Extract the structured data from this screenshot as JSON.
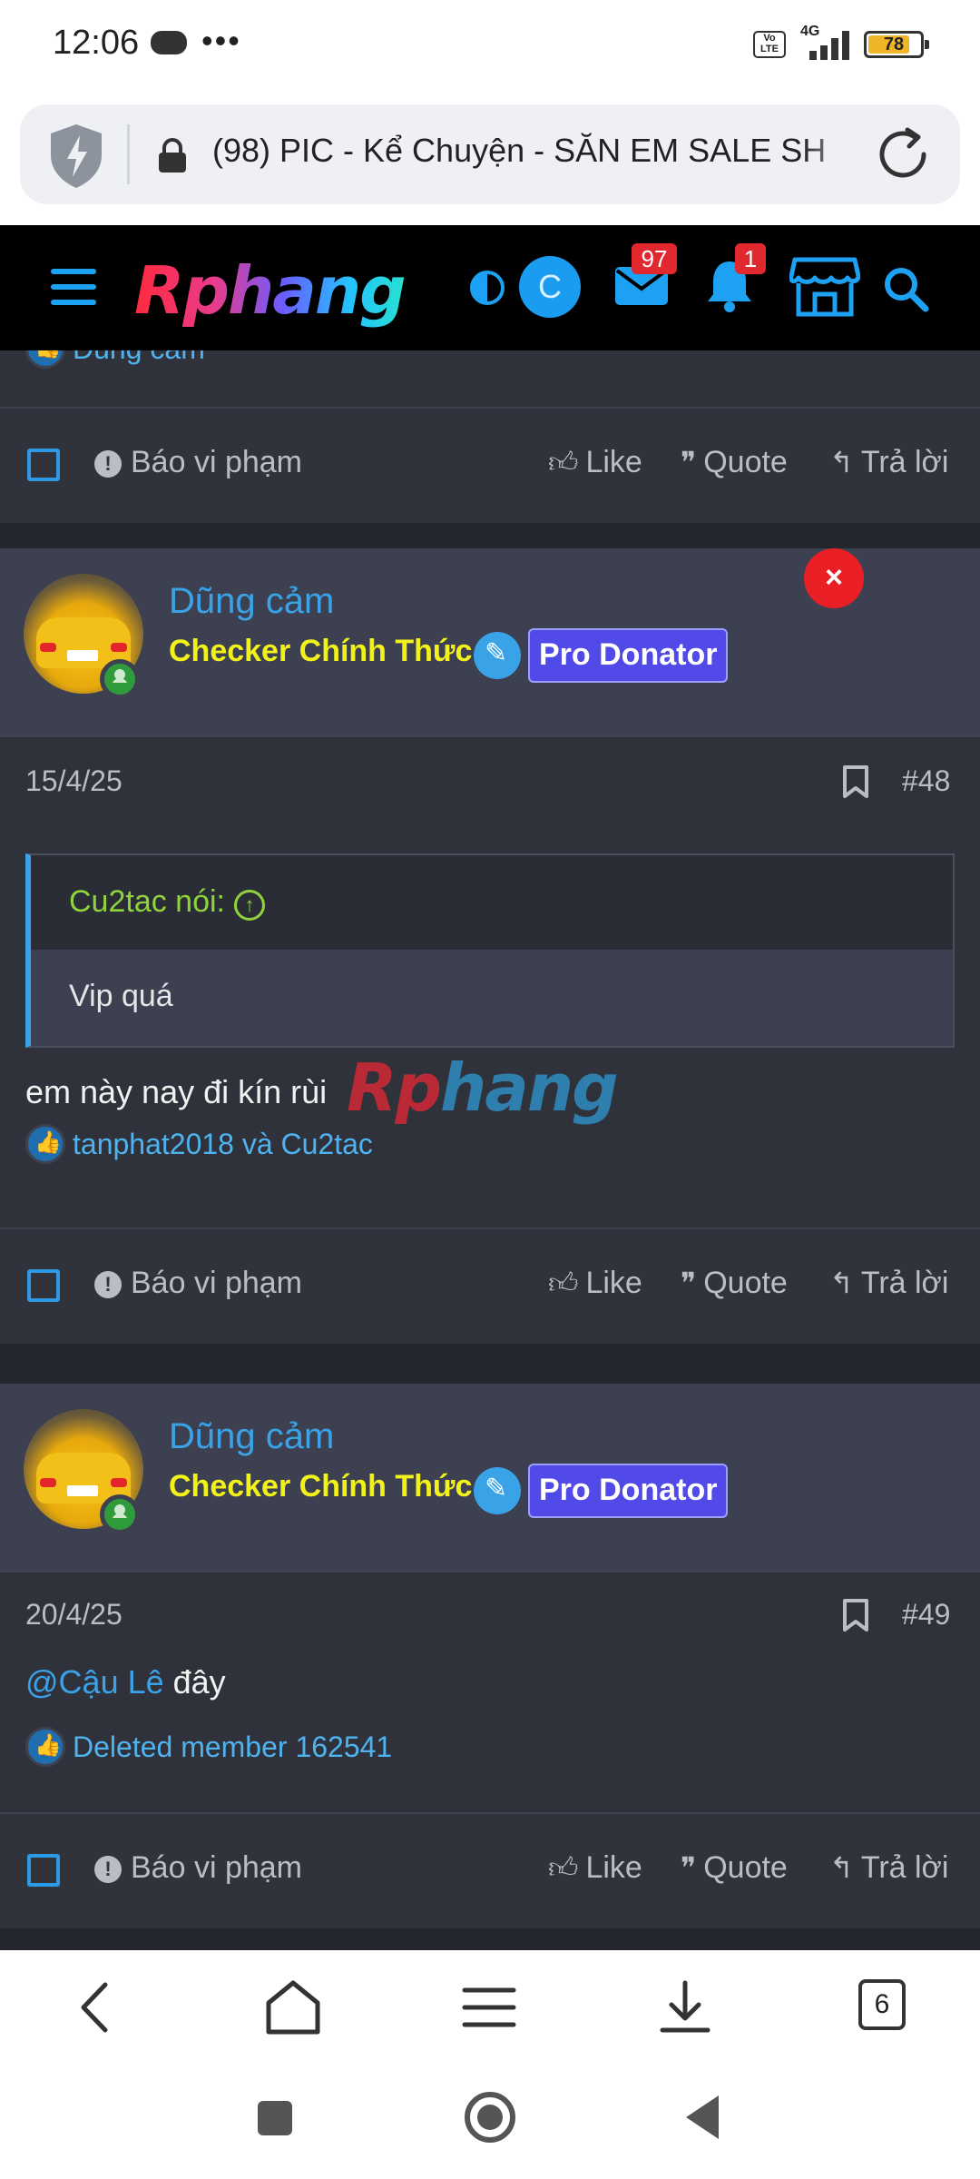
{
  "status_bar": {
    "time": "12:06",
    "network": "4G",
    "volte": "Vo LTE",
    "battery": "78",
    "battery_level": 0.78
  },
  "browser": {
    "url_text": "(98) PIC - Kể Chuyện - SĂN EM SALE SH",
    "tab_count": "6"
  },
  "site": {
    "logo": "Rphang",
    "user_initial": "C",
    "messages_count": "97",
    "alerts_count": "1"
  },
  "prev_post": {
    "reaction_text": "Dũng cảm"
  },
  "actions": {
    "report": "Báo vi phạm",
    "like": "Like",
    "quote": "Quote",
    "reply": "Trả lời"
  },
  "posts": [
    {
      "author": "Dũng cảm",
      "user_title": "Checker Chính Thức",
      "banner": "Pro Donator",
      "date": "15/4/25",
      "number": "#48",
      "quote": {
        "author": "Cu2tac nói:",
        "text": "Vip quá"
      },
      "message": "em này nay đi kín rùi",
      "reactions": "tanphat2018 và Cu2tac"
    },
    {
      "author": "Dũng cảm",
      "user_title": "Checker Chính Thức",
      "banner": "Pro Donator",
      "date": "20/4/25",
      "number": "#49",
      "mention": "@Cậu Lê",
      "message": " đây",
      "reactions": "Deleted member 162541"
    }
  ],
  "watermark": "Rphang",
  "colors": {
    "accent": "#3aa3e8",
    "user_title": "#f2f21a",
    "banner_bg": "#5149e8",
    "quote_author": "#8fd33a",
    "close": "#ea1f25"
  }
}
